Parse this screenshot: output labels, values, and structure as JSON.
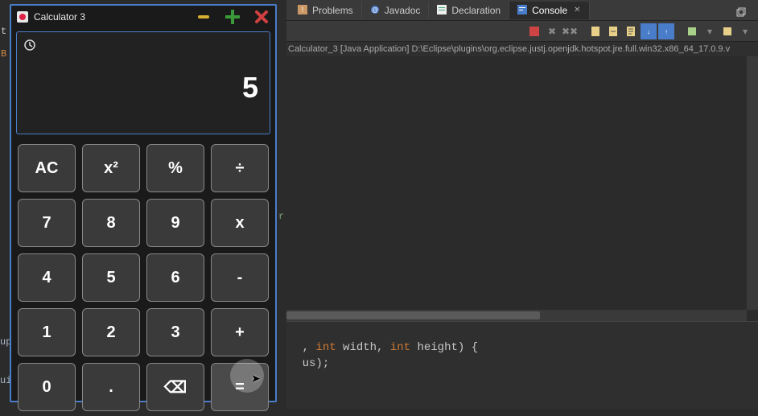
{
  "calculator": {
    "title": "Calculator 3",
    "display": "5",
    "buttons": {
      "ac": "AC",
      "square": "x²",
      "percent": "%",
      "divide": "÷",
      "seven": "7",
      "eight": "8",
      "nine": "9",
      "multiply": "x",
      "four": "4",
      "five": "5",
      "six": "6",
      "minus": "-",
      "one": "1",
      "two": "2",
      "three": "3",
      "plus": "+",
      "zero": "0",
      "dot": ".",
      "backspace": "⌫",
      "equals": "="
    }
  },
  "eclipse": {
    "tabs": {
      "problems": "Problems",
      "javadoc": "Javadoc",
      "declaration": "Declaration",
      "console": "Console"
    },
    "console_status": "Calculator_3 [Java Application] D:\\Eclipse\\plugins\\org.eclipse.justj.openjdk.hotspot.jre.full.win32.x86_64_17.0.9.v",
    "editor": {
      "line1_prefix": ", ",
      "line1_kw1": "int",
      "line1_mid1": " width, ",
      "line1_kw2": "int",
      "line1_mid2": " height) {",
      "line2": "us);"
    }
  },
  "gutter": {
    "t": "t",
    "b": "B",
    "r": "r",
    "up": "up",
    "ui": "ui"
  }
}
